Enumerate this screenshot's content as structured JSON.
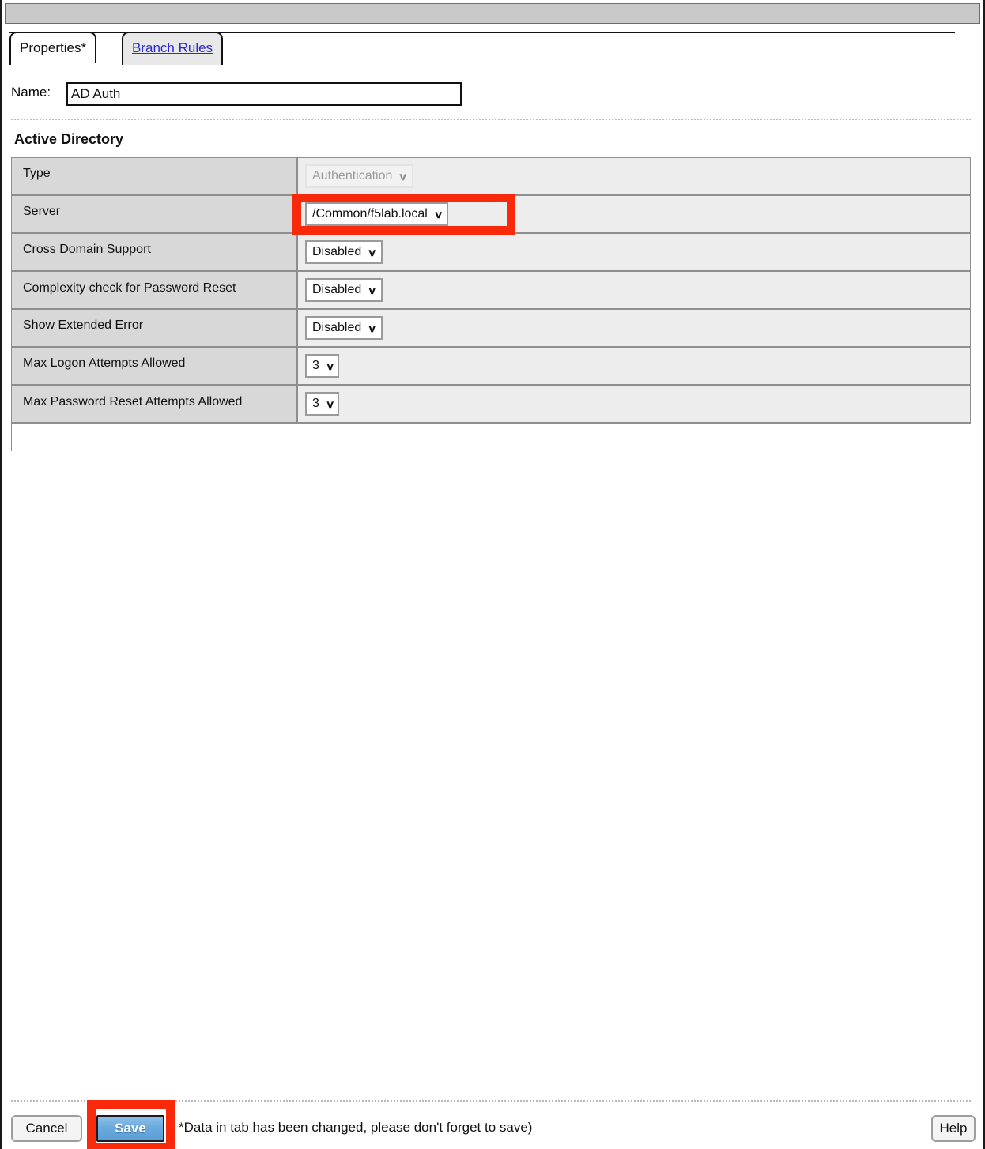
{
  "window": {
    "titlebar_text": ""
  },
  "tabs": [
    {
      "label": "Properties*",
      "active": true
    },
    {
      "label": "Branch Rules",
      "active": false
    }
  ],
  "name_field": {
    "label": "Name:",
    "value": "AD Auth",
    "placeholder": ""
  },
  "section": {
    "title": "Active Directory"
  },
  "properties": {
    "rows": [
      {
        "label": "Type",
        "control": "select",
        "value": "Authentication",
        "disabled": true,
        "highlighted": false
      },
      {
        "label": "Server",
        "control": "select",
        "value": "/Common/f5lab.local",
        "disabled": false,
        "highlighted": true
      },
      {
        "label": "Cross Domain Support",
        "control": "select",
        "value": "Disabled",
        "disabled": false,
        "highlighted": false
      },
      {
        "label": "Complexity check for Password Reset",
        "control": "select",
        "value": "Disabled",
        "disabled": false,
        "highlighted": false
      },
      {
        "label": "Show Extended Error",
        "control": "select",
        "value": "Disabled",
        "disabled": false,
        "highlighted": false
      },
      {
        "label": "Max Logon Attempts Allowed",
        "control": "select",
        "value": "3",
        "disabled": false,
        "highlighted": false
      },
      {
        "label": "Max Password Reset Attempts Allowed",
        "control": "select",
        "value": "3",
        "disabled": false,
        "highlighted": false
      }
    ]
  },
  "footer": {
    "cancel_label": "Cancel",
    "save_label": "Save",
    "help_label": "Help",
    "note": "*Data in tab has been changed, please don't forget to save)"
  },
  "icons": {
    "caret": "⌄",
    "chevron_down": "chevron-down-icon"
  },
  "colors": {
    "highlight_red": "#f92a0c",
    "save_blue": "#6aaade",
    "label_cell_bg": "#d8d8d8",
    "value_cell_bg": "#ededed",
    "titlebar_bg": "#c8c8c8",
    "link_blue": "#2b2bcf"
  }
}
